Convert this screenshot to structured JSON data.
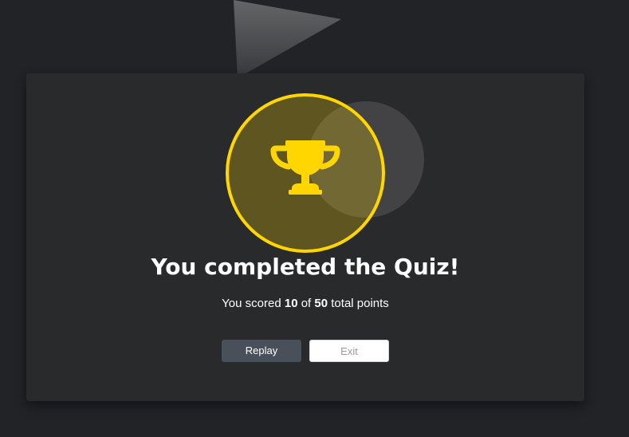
{
  "background": {
    "decoration": "triangle-shape"
  },
  "result": {
    "icon": "trophy-icon",
    "title": "You completed the Quiz!",
    "score_prefix": "You scored",
    "score_value": "10",
    "score_middle": "of",
    "score_total": "50",
    "score_suffix": "total points"
  },
  "actions": {
    "replay_label": "Replay",
    "exit_label": "Exit"
  },
  "colors": {
    "page_background": "#212327",
    "card_background": "#292a2c",
    "accent": "#ffd600",
    "replay_button": "#4a505a",
    "exit_button": "#ffffff"
  }
}
